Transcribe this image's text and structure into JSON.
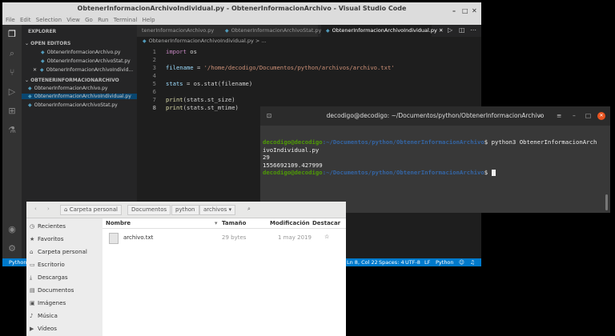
{
  "vscode": {
    "title": "ObtenerInformacionArchivoIndividual.py - ObtenerInformacionArchivo - Visual Studio Code",
    "menu": [
      "File",
      "Edit",
      "Selection",
      "View",
      "Go",
      "Run",
      "Terminal",
      "Help"
    ],
    "sidebar": {
      "header": "EXPLORER",
      "open_editors_label": "OPEN EDITORS",
      "open_editors": [
        "ObtenerInformacionArchivo.py",
        "ObtenerInformacionArchivoStat.py",
        "ObtenerInformacionArchivoIndivid..."
      ],
      "folder_label": "OBTENERINFORMACIONARCHIVO",
      "files": [
        "ObtenerInformacionArchivo.py",
        "ObtenerInformacionArchivoIndividual.py",
        "ObtenerInformacionArchivoStat.py"
      ]
    },
    "tabs": [
      "tenerInformacionArchivo.py",
      "ObtenerInformacionArchivoStat.py",
      "ObtenerInformacionArchivoIndividual.py"
    ],
    "breadcrumb": "ObtenerInformacionArchivoIndividual.py > ...",
    "code": {
      "line_numbers": [
        "1",
        "2",
        "3",
        "4",
        "5",
        "6",
        "7",
        "8"
      ],
      "l1_kw": "import",
      "l1_rest": " os",
      "l3_var": "filename",
      "l3_eq": " = ",
      "l3_str": "'/home/decodigo/Documentos/python/archivos/archivo.txt'",
      "l5_var": "stats",
      "l5_rest": " = os.stat(filename)",
      "l7_fn": "print",
      "l7_rest": "(stats.st_size)",
      "l8_fn": "print",
      "l8_rest": "(stats.st_mtime)"
    },
    "status": {
      "left": "Python 3",
      "position": "Ln 8, Col 22",
      "spaces": "Spaces: 4",
      "encoding": "UTF-8",
      "eol": "LF",
      "language": "Python"
    }
  },
  "terminal": {
    "title": "decodigo@decodigo: ~/Documentos/python/ObtenerInformacionArchivo",
    "user": "decodigo@decodigo",
    "path": ":~/Documentos/python/ObtenerInformacionArchivo",
    "command": "$ python3 ObtenerInformacionArch",
    "command_wrap": "ivoIndividual.py",
    "out1": "29",
    "out2": "1556692109.427999",
    "prompt_end": "$ "
  },
  "filemgr": {
    "breadcrumbs": [
      "Carpeta personal",
      "Documentos",
      "python",
      "archivos"
    ],
    "places": [
      "Recientes",
      "Favoritos",
      "Carpeta personal",
      "Escritorio",
      "Descargas",
      "Documentos",
      "Imágenes",
      "Música",
      "Vídeos"
    ],
    "columns": {
      "name": "Nombre",
      "size": "Tamaño",
      "modified": "Modificación",
      "star": "Destacar"
    },
    "file": {
      "name": "archivo.txt",
      "size": "29 bytes",
      "modified": "1 may 2019"
    }
  }
}
